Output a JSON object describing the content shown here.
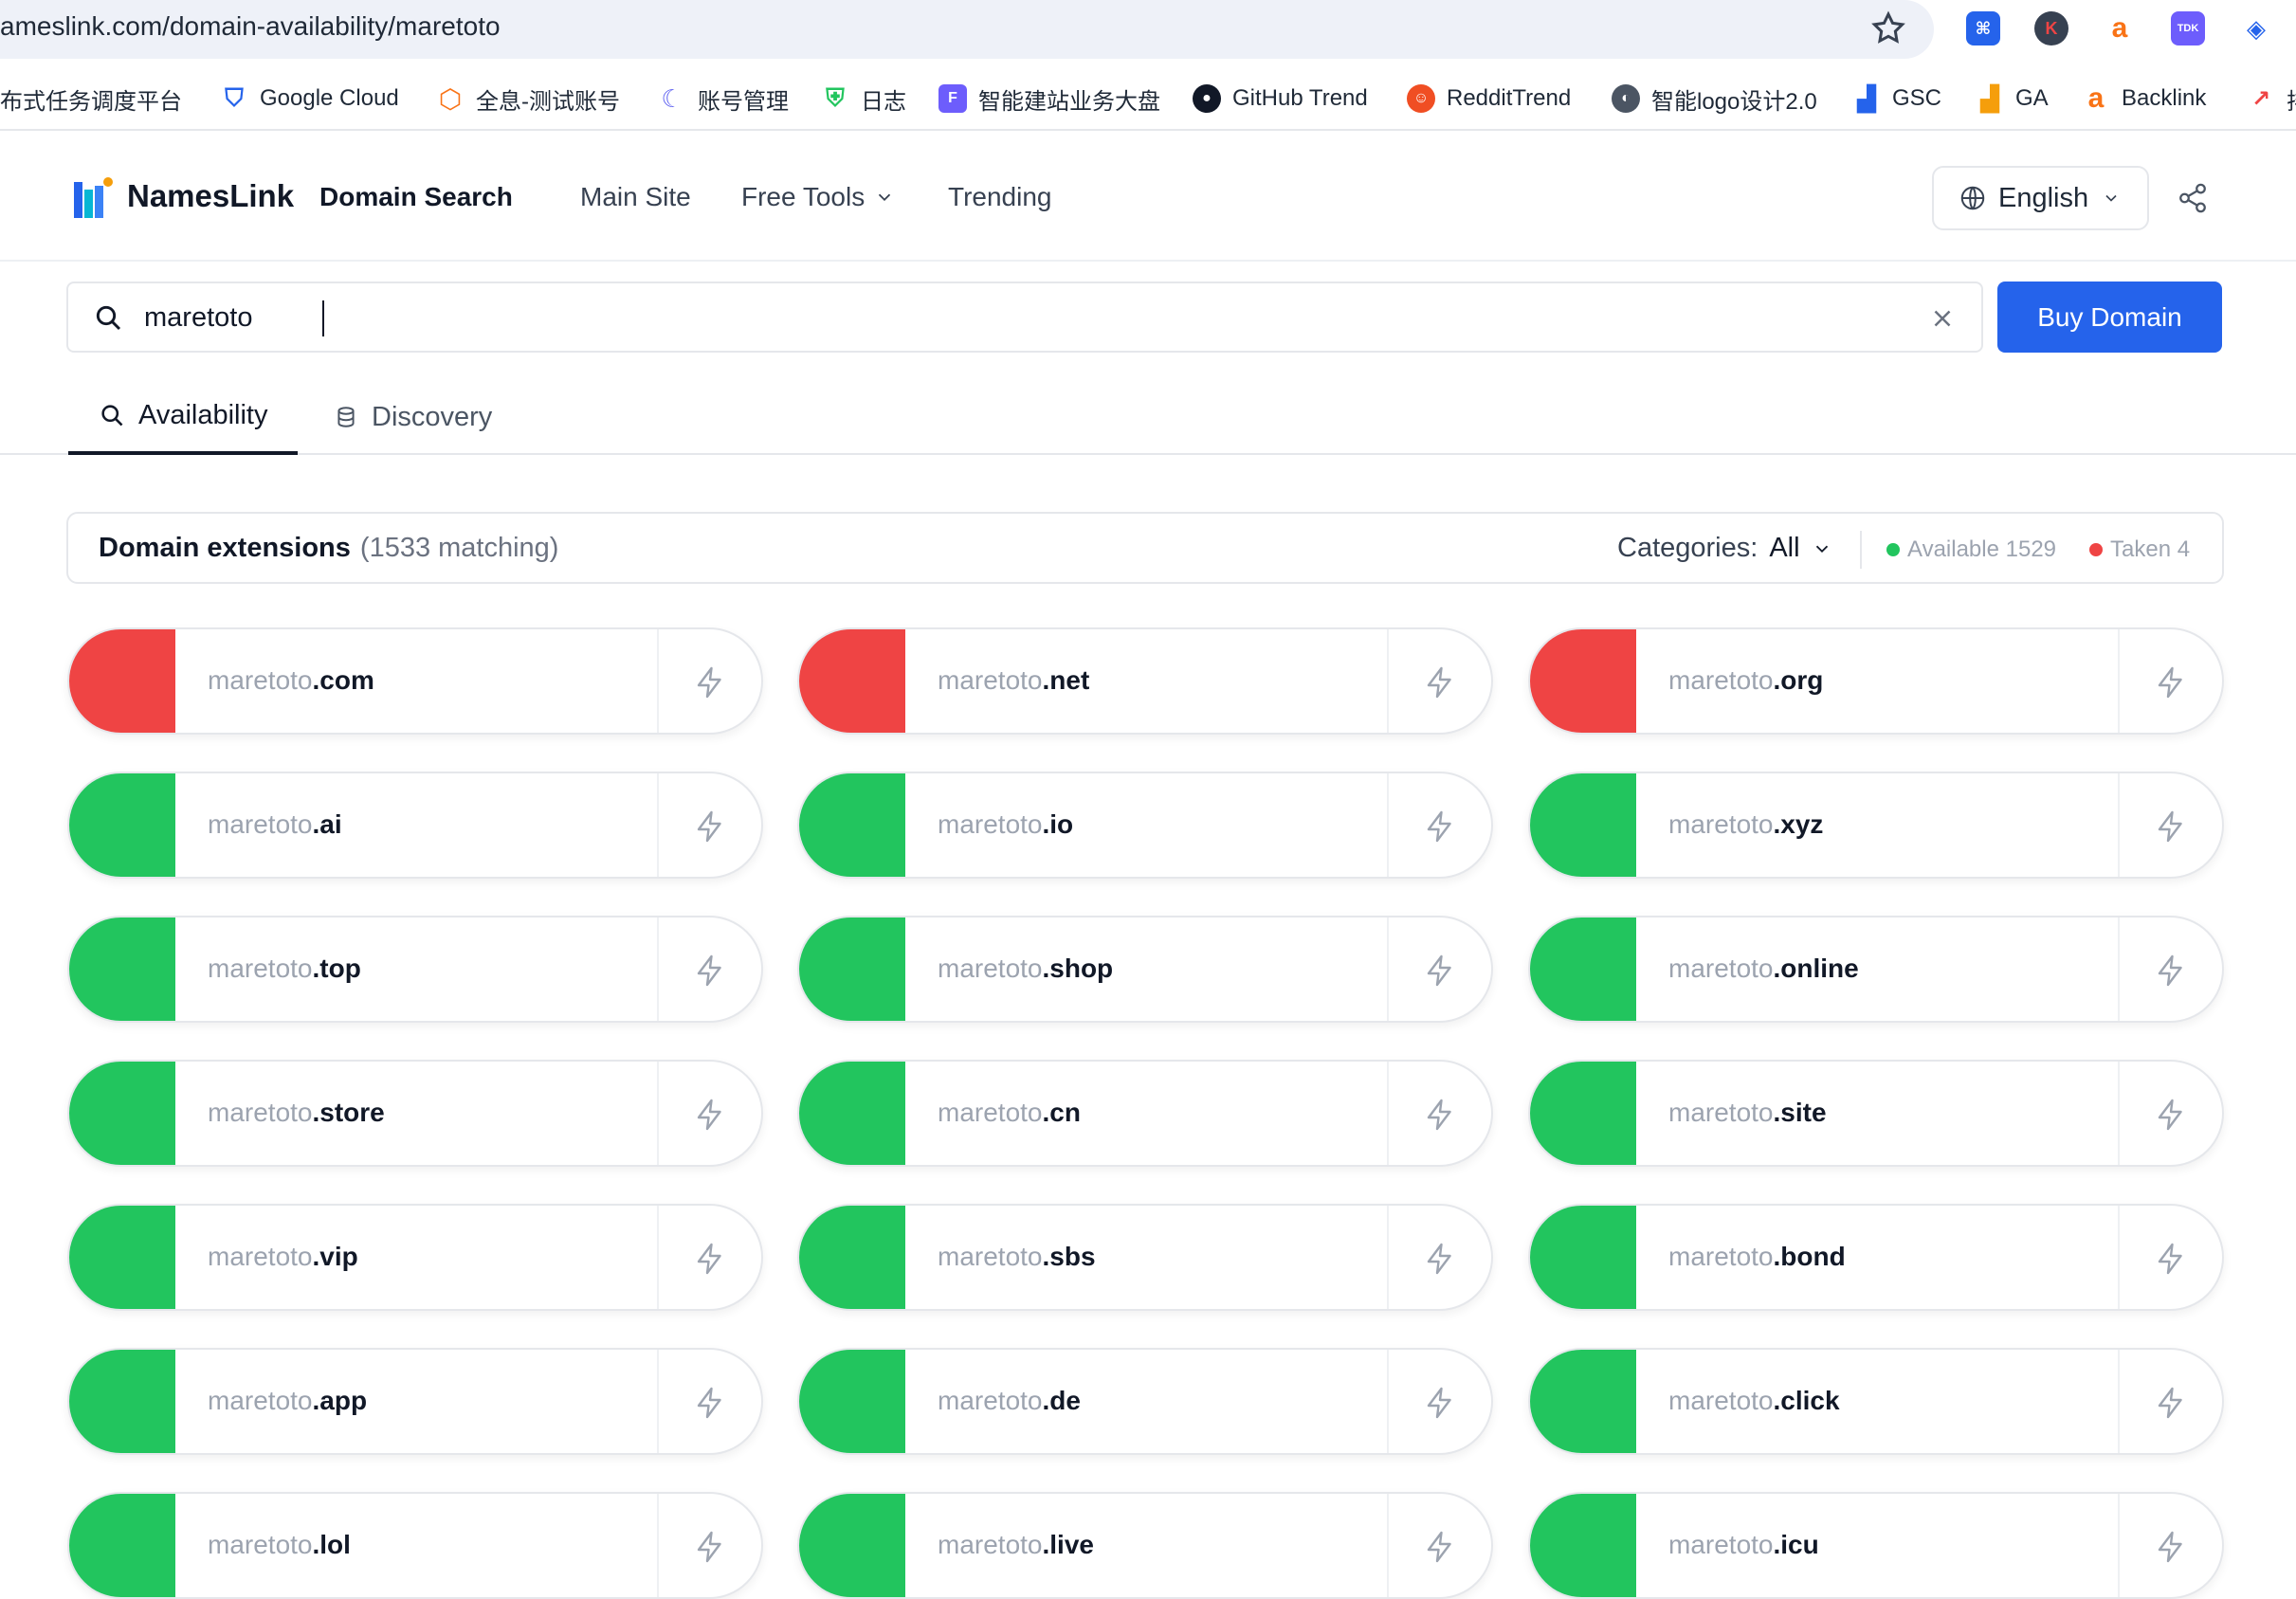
{
  "browser": {
    "url": "ameslink.com/domain-availability/maretoto",
    "bookmarks": [
      {
        "label": "分布式任务调度平台",
        "icon": "task-scheduler-icon"
      },
      {
        "label": "Google Cloud",
        "icon": "google-cloud-icon"
      },
      {
        "label": "全息-测试账号",
        "icon": "hexagon-icon"
      },
      {
        "label": "账号管理",
        "icon": "account-icon"
      },
      {
        "label": "日志",
        "icon": "shield-log-icon"
      },
      {
        "label": "智能建站业务大盘",
        "icon": "f-app-icon"
      },
      {
        "label": "GitHub Trend",
        "icon": "github-icon"
      },
      {
        "label": "RedditTrend",
        "icon": "reddit-icon"
      },
      {
        "label": "智能logo设计2.0",
        "icon": "globe-icon"
      },
      {
        "label": "GSC",
        "icon": "bar-chart-icon"
      },
      {
        "label": "GA",
        "icon": "analytics-icon"
      },
      {
        "label": "Backlink",
        "icon": "ahrefs-icon"
      },
      {
        "label": "排",
        "icon": "trend-icon"
      }
    ]
  },
  "header": {
    "brand": "NamesLink",
    "subbrand": "Domain Search",
    "nav": {
      "main_site": "Main Site",
      "free_tools": "Free Tools",
      "trending": "Trending"
    },
    "language": "English"
  },
  "search": {
    "value": "maretoto",
    "button": "Buy Domain"
  },
  "tabs": {
    "availability": "Availability",
    "discovery": "Discovery"
  },
  "extensions": {
    "title": "Domain extensions",
    "count": "(1533 matching)",
    "categories_label": "Categories:",
    "categories_value": "All",
    "available": "Available 1529",
    "taken": "Taken 4"
  },
  "colors": {
    "available": "#22c55e",
    "taken": "#ef4444",
    "primary": "#2563eb"
  },
  "domains": [
    {
      "base": "maretoto",
      "tld": ".com",
      "status": "taken"
    },
    {
      "base": "maretoto",
      "tld": ".net",
      "status": "taken"
    },
    {
      "base": "maretoto",
      "tld": ".org",
      "status": "taken"
    },
    {
      "base": "maretoto",
      "tld": ".ai",
      "status": "available"
    },
    {
      "base": "maretoto",
      "tld": ".io",
      "status": "available"
    },
    {
      "base": "maretoto",
      "tld": ".xyz",
      "status": "available"
    },
    {
      "base": "maretoto",
      "tld": ".top",
      "status": "available"
    },
    {
      "base": "maretoto",
      "tld": ".shop",
      "status": "available"
    },
    {
      "base": "maretoto",
      "tld": ".online",
      "status": "available"
    },
    {
      "base": "maretoto",
      "tld": ".store",
      "status": "available"
    },
    {
      "base": "maretoto",
      "tld": ".cn",
      "status": "available"
    },
    {
      "base": "maretoto",
      "tld": ".site",
      "status": "available"
    },
    {
      "base": "maretoto",
      "tld": ".vip",
      "status": "available"
    },
    {
      "base": "maretoto",
      "tld": ".sbs",
      "status": "available"
    },
    {
      "base": "maretoto",
      "tld": ".bond",
      "status": "available"
    },
    {
      "base": "maretoto",
      "tld": ".app",
      "status": "available"
    },
    {
      "base": "maretoto",
      "tld": ".de",
      "status": "available"
    },
    {
      "base": "maretoto",
      "tld": ".click",
      "status": "available"
    },
    {
      "base": "maretoto",
      "tld": ".lol",
      "status": "available"
    },
    {
      "base": "maretoto",
      "tld": ".live",
      "status": "available"
    },
    {
      "base": "maretoto",
      "tld": ".icu",
      "status": "available"
    }
  ]
}
